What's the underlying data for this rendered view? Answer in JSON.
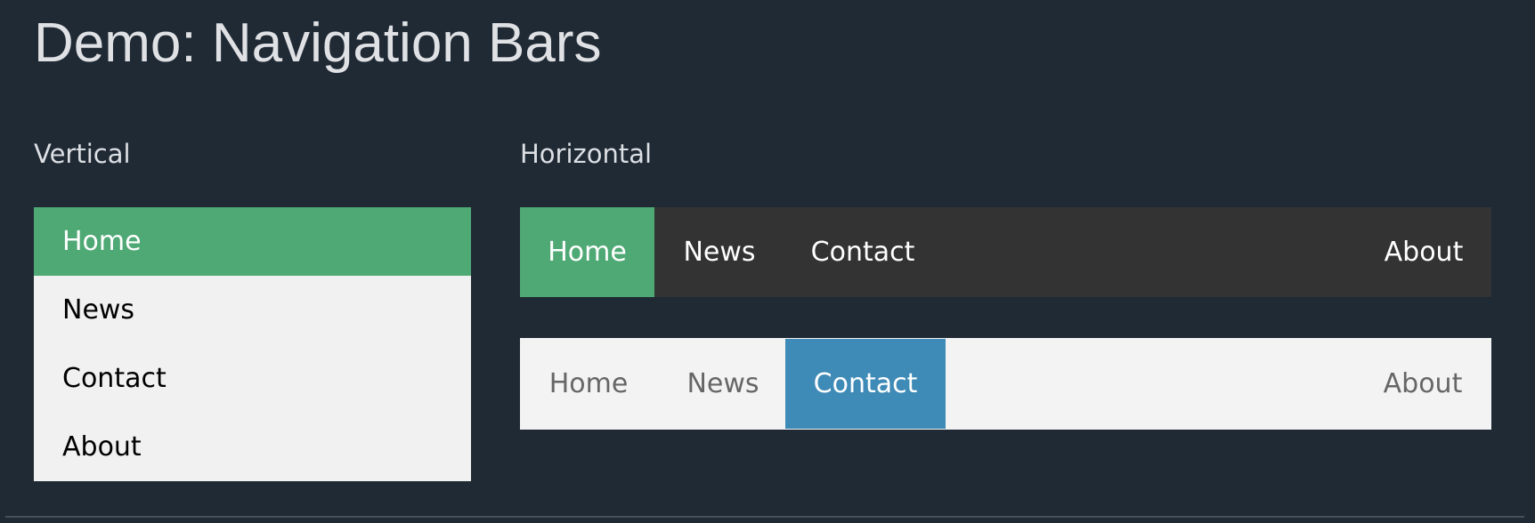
{
  "page": {
    "title": "Demo: Navigation Bars"
  },
  "vertical": {
    "heading": "Vertical",
    "items": [
      {
        "label": "Home",
        "active": true
      },
      {
        "label": "News",
        "active": false
      },
      {
        "label": "Contact",
        "active": false
      },
      {
        "label": "About",
        "active": false
      }
    ]
  },
  "horizontal": {
    "heading": "Horizontal",
    "dark_nav": {
      "items": [
        {
          "label": "Home",
          "active": true
        },
        {
          "label": "News",
          "active": false
        },
        {
          "label": "Contact",
          "active": false
        },
        {
          "label": "About",
          "active": false
        }
      ]
    },
    "light_nav": {
      "items": [
        {
          "label": "Home",
          "active": false
        },
        {
          "label": "News",
          "active": false
        },
        {
          "label": "Contact",
          "active": true
        },
        {
          "label": "About",
          "active": false
        }
      ]
    }
  },
  "colors": {
    "background": "#202a35",
    "active_green": "#4fa975",
    "active_blue": "#3f8bb7",
    "dark_nav_bg": "#333333",
    "light_nav_bg": "#f3f3f3",
    "vertical_nav_bg": "#f1f1f1"
  }
}
